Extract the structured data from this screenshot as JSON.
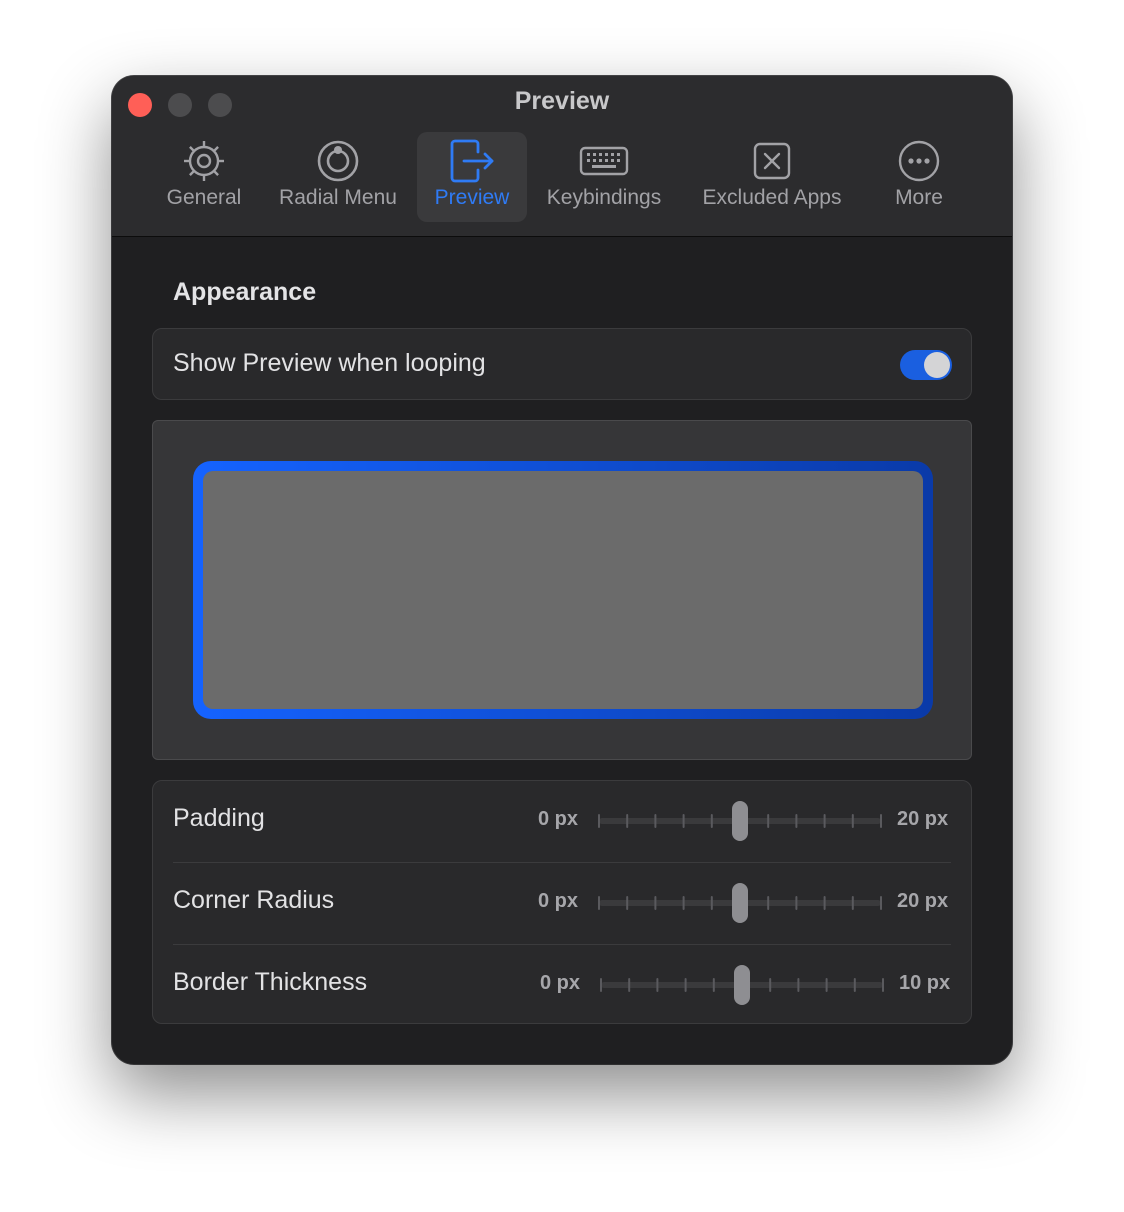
{
  "window": {
    "title": "Preview"
  },
  "tabs": [
    {
      "label": "General",
      "icon": "gear-icon"
    },
    {
      "label": "Radial Menu",
      "icon": "radial-menu-icon"
    },
    {
      "label": "Preview",
      "icon": "preview-exit-icon",
      "active": true
    },
    {
      "label": "Keybindings",
      "icon": "keyboard-icon"
    },
    {
      "label": "Excluded Apps",
      "icon": "excluded-apps-icon"
    },
    {
      "label": "More",
      "icon": "more-icon"
    }
  ],
  "appearance": {
    "title": "Appearance",
    "show_preview": {
      "label": "Show Preview when looping",
      "enabled": true
    }
  },
  "sliders": [
    {
      "label": "Padding",
      "min_label": "0 px",
      "max_label": "20 px",
      "value": 10,
      "min": 0,
      "max": 20
    },
    {
      "label": "Corner Radius",
      "min_label": "0 px",
      "max_label": "20 px",
      "value": 10,
      "min": 0,
      "max": 20
    },
    {
      "label": "Border Thickness",
      "min_label": "0 px",
      "max_label": "10 px",
      "value": 5,
      "min": 0,
      "max": 10
    }
  ],
  "colors": {
    "accent": "#1a5fe0",
    "close": "#ff5f57",
    "preview_gradient_start": "#1563ff",
    "preview_gradient_end": "#0a3aa8"
  }
}
